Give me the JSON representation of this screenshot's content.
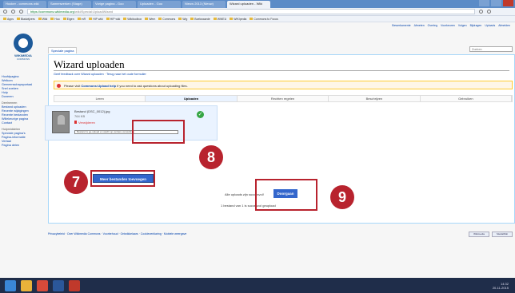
{
  "browser": {
    "tabs": [
      "Hooker - commons wiki",
      "Samenwerken (Stage)",
      "Vorige pagina - Goo",
      "Uploaden - Goo",
      "Nieuw 2013 (Nieuw)",
      "Wizard uploaden - Wiki"
    ],
    "active_tab_index": 5,
    "url_host": "https://commons.wikimedia.org",
    "url_path": "/wiki/Special:UploadWizard",
    "bookmarks": [
      "Apps",
      "Bladwijzers",
      "Wiki",
      "Hoo",
      "Eigen",
      "mR",
      "HIP wiki",
      "HIP wiki",
      "Wikitoolbox",
      "Wem",
      "Commons",
      "Wig",
      "Boekwaarde",
      "WWEU",
      "WIKIpedia",
      "Commons to Focus"
    ],
    "window_colors": {
      "bar": "#5b8bc7",
      "close": "#c0392b"
    }
  },
  "personal_tools": [
    "Bewerkamente",
    "Afmeten",
    "Overleg",
    "Voorkeuren",
    "Volgen",
    "Bijdragen",
    "Uploads",
    "Afmelden"
  ],
  "search": {
    "placeholder": "Zoeken"
  },
  "page_tab": "Speciale pagina",
  "logo": {
    "title": "WIKIMEDIA",
    "subtitle": "COMMONS"
  },
  "sidebar": {
    "groups": [
      {
        "items": [
          "Hoofdpagina",
          "Welkom",
          "Gemeenschapsportaal",
          "Snel zoeken",
          "Hulp",
          "Doneren"
        ]
      },
      {
        "heading": "Deelnemen",
        "items": [
          "Bestand uploaden",
          "Recente wijzigingen",
          "Recente bestanden",
          "Willekeurige pagina",
          "Contact"
        ]
      },
      {
        "heading": "Hulpmiddelen",
        "items": [
          "Speciale pagina's",
          "Pagina-informatie",
          "Vertaal",
          "Pagina delen"
        ]
      }
    ]
  },
  "main": {
    "title": "Wizard uploaden",
    "links": "Geef feedback over Wizard uploaden · Terug naar het oude formulier",
    "notice_prefix": "Please visit ",
    "notice_link": "Commons:Upload help",
    "notice_suffix": " if you need to ask questions about uploading files.",
    "steps": [
      "Leren",
      "Uploaden",
      "Rechten regelen",
      "Beschrijven",
      "Gebruiken"
    ],
    "current_step_index": 1
  },
  "file": {
    "name": "Bestand (DSC_0012).jpg",
    "size": "764 KB",
    "remove_label": "Verwijderen",
    "progress_label": "Bestand is ge-upload en wacht op verdere verwerking",
    "status_icon": "check-circle-icon"
  },
  "buttons": {
    "more_files": "Meer bestanden toevoegen",
    "upload": "Doorgaan",
    "upload_question": "Alle uploads zijn succesvol!"
  },
  "upload_status": "1 bestand van 1 is succesvol geupload",
  "footer": "Privacybeleid · Over Wikimedia Commons · Voorbehoud · Ontwikkelaars · Cookieverklaring · Mobiele weergave",
  "footer_logos": [
    "Wikimedia",
    "MediaWiki"
  ],
  "annotations": {
    "seven": "7",
    "eight": "8",
    "nine": "9",
    "color": "#b8232e"
  },
  "taskbar": {
    "time": "14:32",
    "date": "20-11-2015",
    "icons": [
      "windows-start-icon",
      "explorer-icon",
      "chrome-icon",
      "word-icon",
      "paint-icon"
    ]
  }
}
